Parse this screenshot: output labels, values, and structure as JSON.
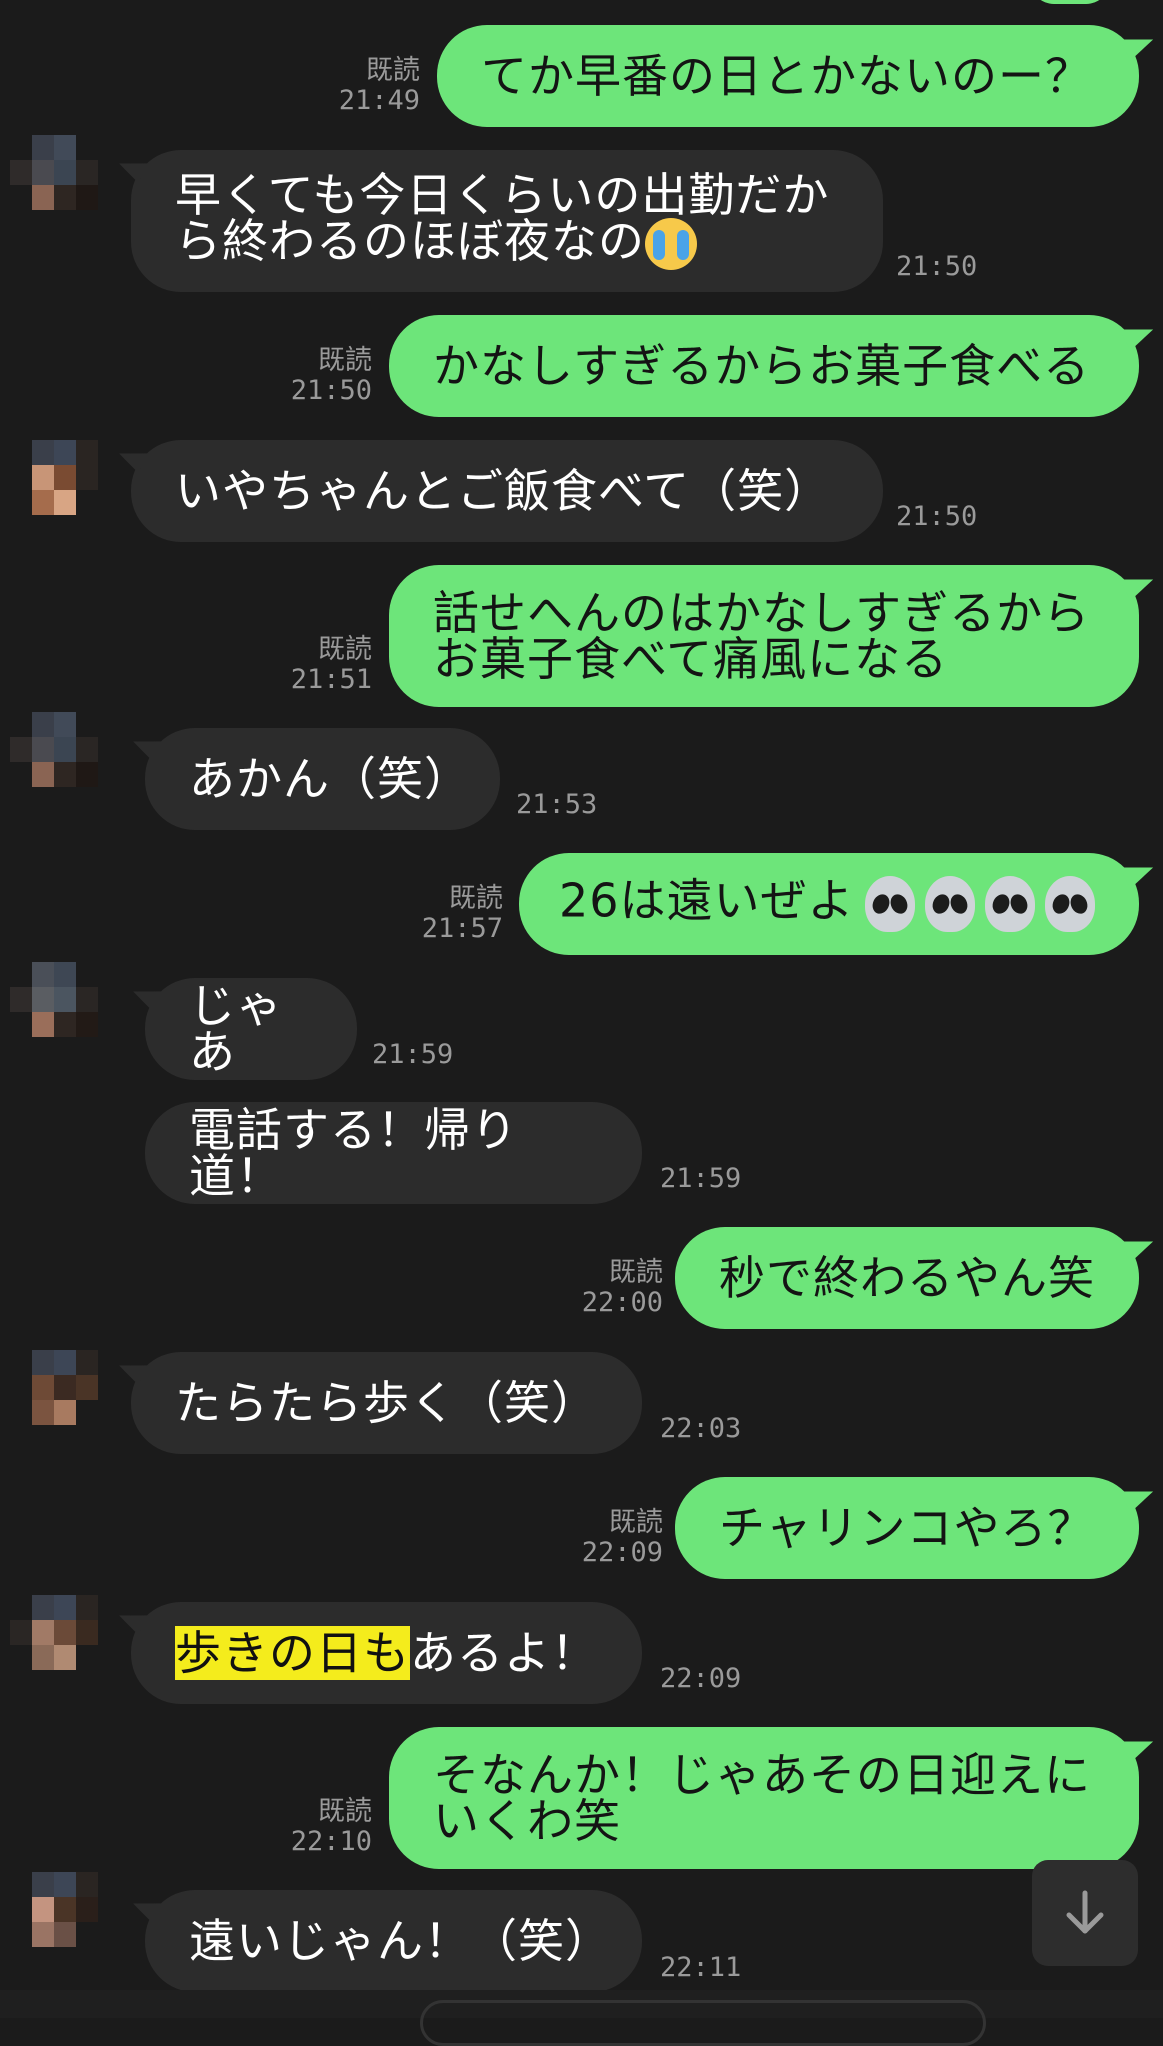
{
  "theme": {
    "background": "#1b1b1b",
    "outgoing_bubble": "#6de57a",
    "incoming_bubble": "#2c2c2c",
    "highlight": "#f4ec1c",
    "meta_text": "#9a9a9a"
  },
  "messages": [
    {
      "direction": "out",
      "text": "てか早番の日とかないのー？",
      "read": "既読",
      "time": "21:49"
    },
    {
      "direction": "in",
      "text": "早くても今日くらいの出勤だか\nら終わるのほぼ夜なの",
      "emoji": "loudly-crying-face",
      "time": "21:50"
    },
    {
      "direction": "out",
      "text": "かなしすぎるからお菓子食べる",
      "read": "既読",
      "time": "21:50"
    },
    {
      "direction": "in",
      "text": "いやちゃんとご飯食べて（笑）",
      "time": "21:50"
    },
    {
      "direction": "out",
      "text": "話せへんのはかなしすぎるから\nお菓子食べて痛風になる",
      "read": "既読",
      "time": "21:51"
    },
    {
      "direction": "in",
      "text": "あかん（笑）",
      "time": "21:53"
    },
    {
      "direction": "out",
      "text": "26は遠いぜよ",
      "emoji": "alien-x4",
      "read": "既読",
      "time": "21:57"
    },
    {
      "direction": "in",
      "text": "じゃあ",
      "time": "21:59"
    },
    {
      "direction": "in",
      "text": "電話する！帰り道！",
      "time": "21:59"
    },
    {
      "direction": "out",
      "text": "秒で終わるやん笑",
      "read": "既読",
      "time": "22:00"
    },
    {
      "direction": "in",
      "text": "たらたら歩く（笑）",
      "time": "22:03"
    },
    {
      "direction": "out",
      "text": "チャリンコやろ？",
      "read": "既読",
      "time": "22:09"
    },
    {
      "direction": "in",
      "text_highlight": "歩きの日も",
      "text": "あるよ！",
      "time": "22:09"
    },
    {
      "direction": "out",
      "text": "そなんか！じゃあその日迎えに\nいくわ笑",
      "read": "既読",
      "time": "22:10"
    },
    {
      "direction": "in",
      "text": "遠いじゃん！（笑）",
      "time": "22:11"
    }
  ],
  "scroll_button": {
    "icon": "arrow-down-icon"
  }
}
